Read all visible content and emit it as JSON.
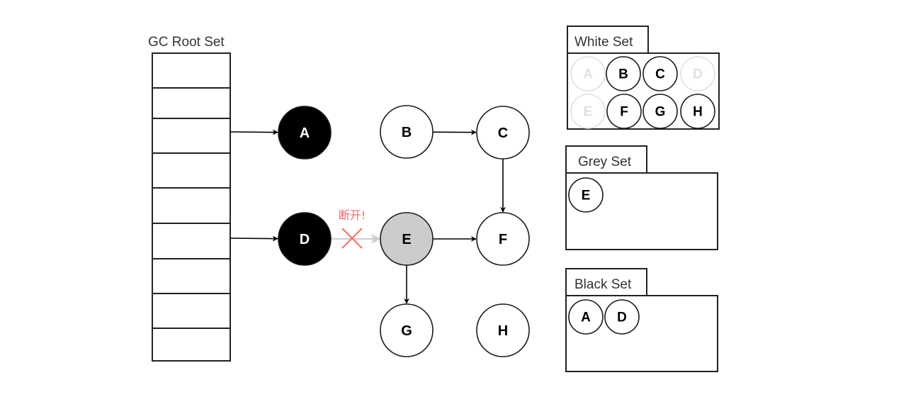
{
  "root_set": {
    "title": "GC Root Set",
    "slot_count": 9
  },
  "colors": {
    "black_fill": "#000000",
    "grey_fill": "#cccccc",
    "white_fill": "#ffffff",
    "stroke": "#000000",
    "faded": "#e0e0e0",
    "cut_red": "#ff6666",
    "cut_arrow": "#cccccc"
  },
  "nodes": [
    {
      "id": "A",
      "label": "A",
      "state": "black"
    },
    {
      "id": "B",
      "label": "B",
      "state": "white"
    },
    {
      "id": "C",
      "label": "C",
      "state": "white"
    },
    {
      "id": "D",
      "label": "D",
      "state": "black"
    },
    {
      "id": "E",
      "label": "E",
      "state": "grey"
    },
    {
      "id": "F",
      "label": "F",
      "state": "white"
    },
    {
      "id": "G",
      "label": "G",
      "state": "white"
    },
    {
      "id": "H",
      "label": "H",
      "state": "white"
    }
  ],
  "edges": [
    {
      "from": "root-slot-3",
      "to": "A",
      "status": "active"
    },
    {
      "from": "root-slot-6",
      "to": "D",
      "status": "active"
    },
    {
      "from": "B",
      "to": "C",
      "status": "active"
    },
    {
      "from": "C",
      "to": "F",
      "status": "active"
    },
    {
      "from": "D",
      "to": "E",
      "status": "cut"
    },
    {
      "from": "E",
      "to": "F",
      "status": "active"
    },
    {
      "from": "E",
      "to": "G",
      "status": "active"
    }
  ],
  "cut_label": "断开!",
  "sets": {
    "white": {
      "title": "White Set",
      "members": [
        {
          "label": "A",
          "faded": true
        },
        {
          "label": "B",
          "faded": false
        },
        {
          "label": "C",
          "faded": false
        },
        {
          "label": "D",
          "faded": true
        },
        {
          "label": "E",
          "faded": true
        },
        {
          "label": "F",
          "faded": false
        },
        {
          "label": "G",
          "faded": false
        },
        {
          "label": "H",
          "faded": false
        }
      ]
    },
    "grey": {
      "title": "Grey Set",
      "members": [
        {
          "label": "E",
          "faded": false
        }
      ]
    },
    "black": {
      "title": "Black Set",
      "members": [
        {
          "label": "A",
          "faded": false
        },
        {
          "label": "D",
          "faded": false
        }
      ]
    }
  }
}
